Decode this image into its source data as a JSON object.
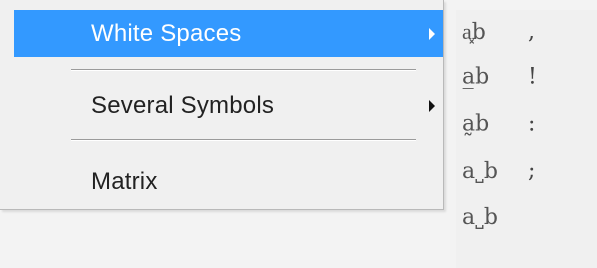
{
  "menu": {
    "items": [
      {
        "label": "White Spaces",
        "has_submenu": true,
        "highlighted": true
      },
      {
        "label": "Several Symbols",
        "has_submenu": true,
        "highlighted": false
      },
      {
        "label": "Matrix",
        "has_submenu": false,
        "highlighted": false
      }
    ]
  },
  "submenu": {
    "rows": [
      {
        "symbol": "a͓b",
        "punctuation": ","
      },
      {
        "symbol": "a̲b",
        "punctuation": "!"
      },
      {
        "symbol": "a̰b",
        "punctuation": ":"
      },
      {
        "symbol": "a˽b",
        "punctuation": ";"
      },
      {
        "symbol": "a˽b",
        "punctuation": ""
      }
    ]
  },
  "colors": {
    "highlight": "#3399ff",
    "menu_bg": "#f0f0f0",
    "text": "#222222"
  },
  "icons": {
    "submenu_arrow": "chevron-right-icon"
  }
}
